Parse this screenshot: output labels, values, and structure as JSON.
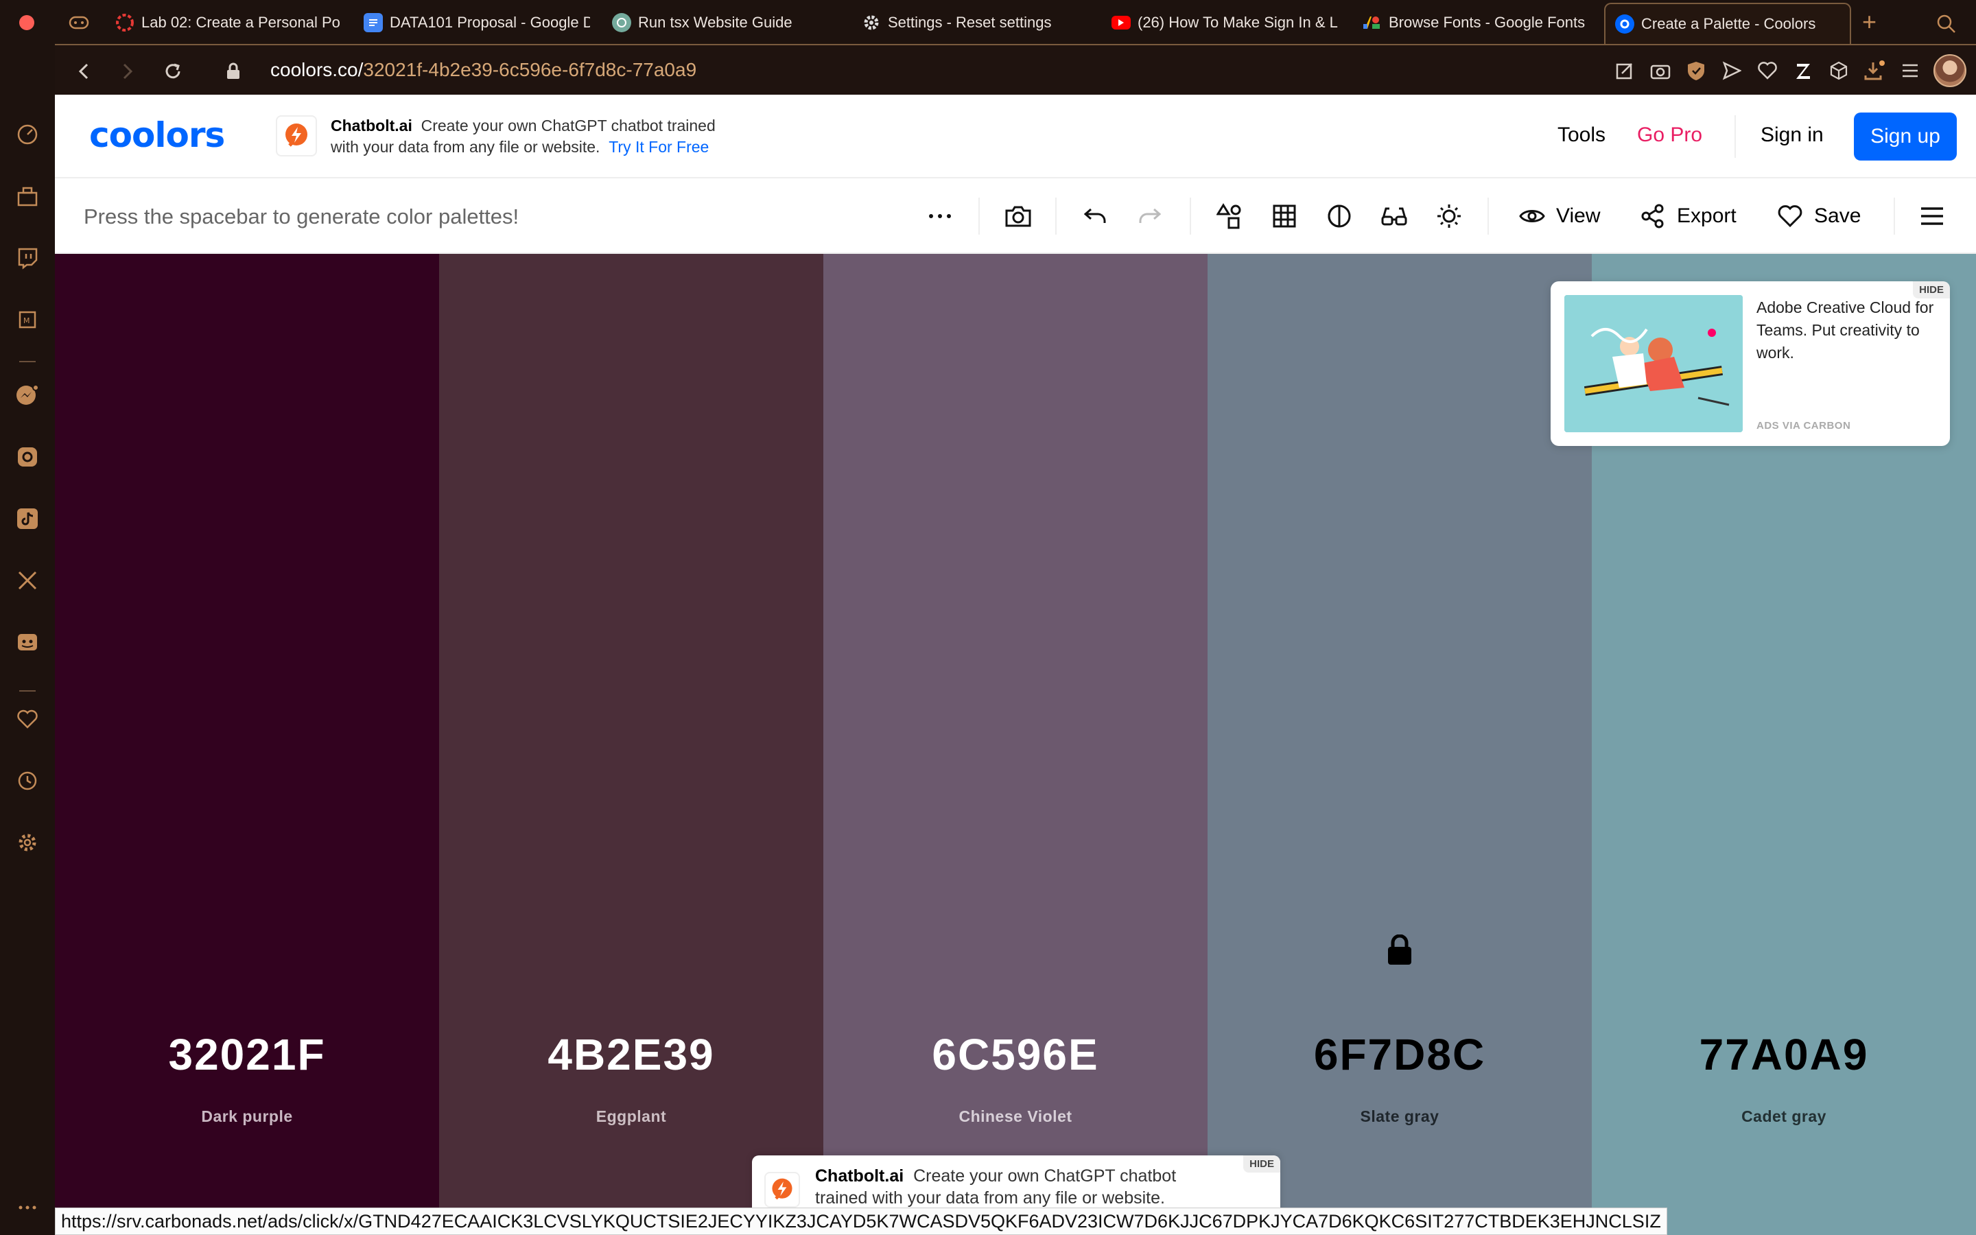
{
  "browser": {
    "tabs": [
      {
        "title": "Lab 02: Create a Personal Po",
        "icon": "spinner-icon",
        "color": "#e53935"
      },
      {
        "title": "DATA101 Proposal - Google D",
        "icon": "docs-icon",
        "color": "#4285f4"
      },
      {
        "title": "Run tsx Website Guide",
        "icon": "chatgpt-icon",
        "color": "#74aa9c"
      },
      {
        "title": "Settings - Reset settings",
        "icon": "gear-icon",
        "color": "#cccccc"
      },
      {
        "title": "(26) How To Make Sign In & L",
        "icon": "youtube-icon",
        "color": "#ff0000"
      },
      {
        "title": "Browse Fonts - Google Fonts",
        "icon": "google-fonts-icon",
        "color": "#4285f4"
      },
      {
        "title": "Create a Palette - Coolors",
        "icon": "coolors-icon",
        "color": "#0066ff",
        "active": true
      }
    ],
    "new_tab": "+",
    "url_host": "coolors.co/",
    "url_path": "32021f-4b2e39-6c596e-6f7d8c-77a0a9",
    "status_url": "https://srv.carbonads.net/ads/click/x/GTND427ECAAICK3LCVSLYKQUCTSIE2JECYYIKZ3JCAYD5K7WCASDV5QKF6ADV23ICW7D6KJJC67DPKJYCA7D6KQKC6SIT277CTBDEK3EHJNCLSIZ"
  },
  "site": {
    "logo": "coolors",
    "header_ad": {
      "brand": "Chatbolt.ai",
      "line1": "Create your own ChatGPT chatbot trained",
      "line2": "with your data from any file or website.",
      "cta": "Try It For Free"
    },
    "nav": {
      "tools": "Tools",
      "go_pro": "Go Pro",
      "sign_in": "Sign in",
      "sign_up": "Sign up"
    },
    "toolbar": {
      "hint": "Press the spacebar to generate color palettes!",
      "view": "View",
      "export": "Export",
      "save": "Save"
    },
    "side_ad": {
      "text": "Adobe Creative Cloud for Teams. Put creativity to work.",
      "via": "ADS VIA CARBON",
      "hide": "HIDE"
    },
    "bottom_ad": {
      "brand": "Chatbolt.ai",
      "text": "Create your own ChatGPT chatbot trained with your data from any file or website.",
      "hide": "HIDE"
    }
  },
  "palette": [
    {
      "hex": "32021F",
      "name": "Dark purple",
      "color": "#32021f",
      "text_color": "#ffffff",
      "name_color": "#c9b7c2"
    },
    {
      "hex": "4B2E39",
      "name": "Eggplant",
      "color": "#4b2e39",
      "text_color": "#ffffff",
      "name_color": "#cdbfc4"
    },
    {
      "hex": "6C596E",
      "name": "Chinese Violet",
      "color": "#6c596e",
      "text_color": "#ffffff",
      "name_color": "#d8d0d8"
    },
    {
      "hex": "6F7D8C",
      "name": "Slate gray",
      "color": "#6f7d8c",
      "text_color": "#000000",
      "name_color": "#1f262c",
      "locked": true
    },
    {
      "hex": "77A0A9",
      "name": "Cadet gray",
      "color": "#77a0a9",
      "text_color": "#000000",
      "name_color": "#223033"
    }
  ]
}
